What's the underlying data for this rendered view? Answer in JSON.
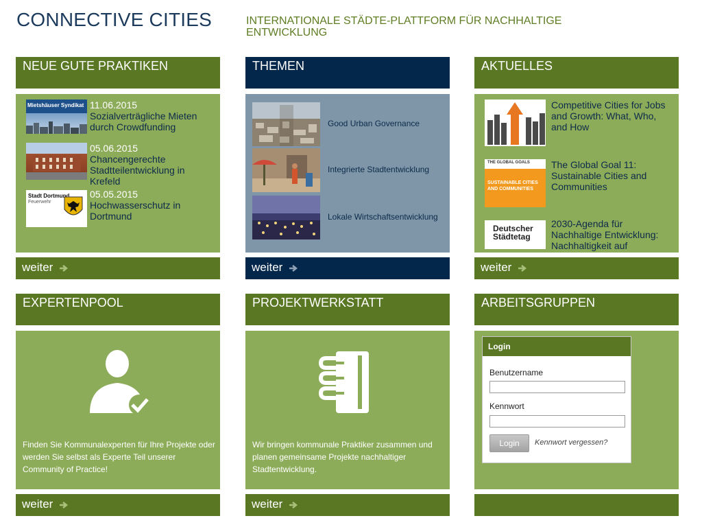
{
  "site": {
    "title": "CONNECTIVE CITIES",
    "tagline": "INTERNATIONALE STÄDTE-PLATTFORM FÜR NACHHALTIGE ENTWICKLUNG"
  },
  "colors": {
    "green_dark": "#5a7824",
    "green_light": "#8dac5a",
    "navy": "#03264b",
    "steel_blue": "#7e96a8",
    "title_blue": "#1b3a5c"
  },
  "more_label": "weiter",
  "practices": {
    "heading": "NEUE GUTE PRAKTIKEN",
    "items": [
      {
        "date": "11.06.2015",
        "title": "Sozialverträgliche Mieten durch Crowdfunding",
        "thumb_text": "Mietshäuser Syndikat"
      },
      {
        "date": "05.06.2015",
        "title": "Chancengerechte Stadtteilentwicklung in Krefeld"
      },
      {
        "date": "05.05.2015",
        "title": "Hochwasserschutz in Dortmund",
        "thumb_text": "Stadt Dortmund",
        "thumb_subtext": "Feuerwehr"
      }
    ]
  },
  "themes": {
    "heading": "THEMEN",
    "items": [
      {
        "label": "Good Urban Governance"
      },
      {
        "label": "Integrierte Stadtentwicklung"
      },
      {
        "label": "Lokale Wirtschaftsentwicklung"
      }
    ]
  },
  "news": {
    "heading": "AKTUELLES",
    "items": [
      {
        "title": "Competitive Cities for Jobs and Growth: What, Who, and How"
      },
      {
        "title": "The Global Goal 11: Sustainable Cities and Communities",
        "thumb_text": "SUSTAINABLE CITIES AND COMMUNITIES",
        "thumb_top": "THE GLOBAL GOALS"
      },
      {
        "title": "2030-Agenda für Nachhaltige Entwicklung: Nachhaltigkeit auf",
        "thumb_text": "Deutscher Städtetag"
      }
    ]
  },
  "experts": {
    "heading": "EXPERTENPOOL",
    "icon": "expert-user-check-icon",
    "description": "Finden Sie Kommunalexperten für Ihre Projekte oder werden Sie selbst als Experte Teil unserer Community of Practice!"
  },
  "workshop": {
    "heading": "PROJEKTWERKSTATT",
    "icon": "notebook-icon",
    "description": "Wir bringen kommunale Praktiker zusammen und planen gemeinsame Projekte nachhaltiger Stadtentwicklung."
  },
  "groups": {
    "heading": "ARBEITSGRUPPEN",
    "login": {
      "title": "Login",
      "username_label": "Benutzername",
      "username_value": "",
      "password_label": "Kennwort",
      "password_value": "",
      "button": "Login",
      "forgot": "Kennwort vergessen?"
    }
  }
}
